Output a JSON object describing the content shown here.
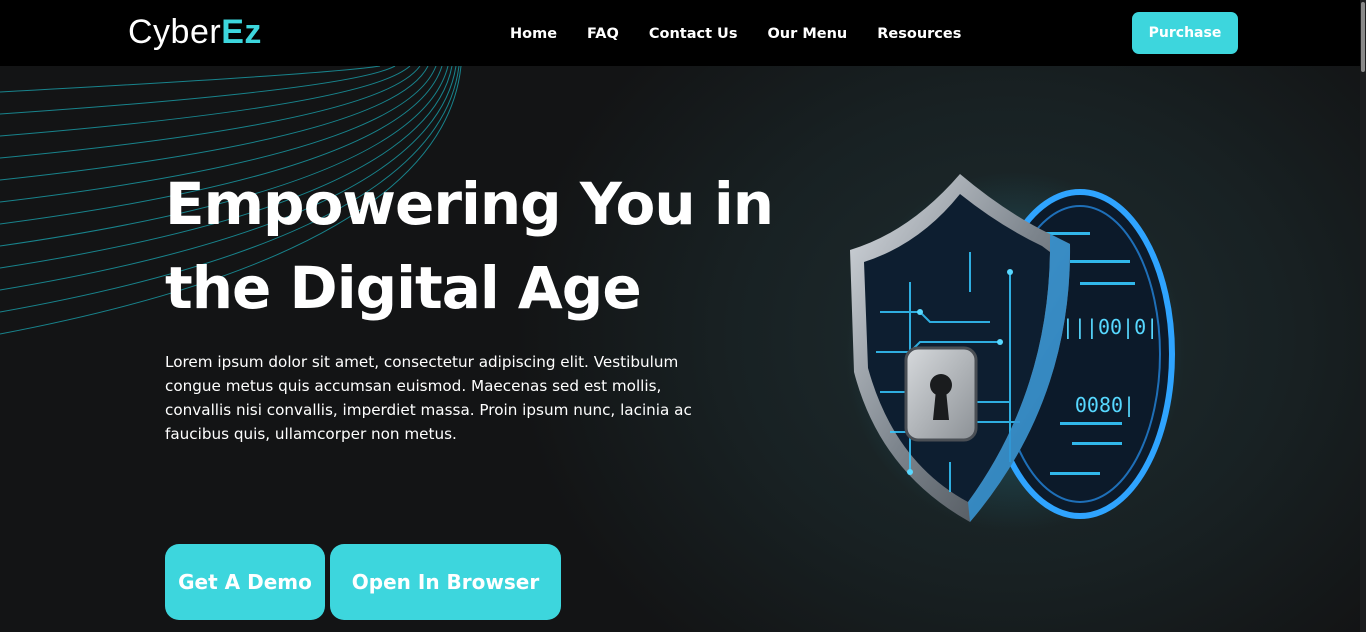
{
  "header": {
    "logo": {
      "part1": "Cyber",
      "part2": "Ez"
    },
    "nav": [
      "Home",
      "FAQ",
      "Contact Us",
      "Our Menu",
      "Resources"
    ],
    "purchase_label": "Purchase"
  },
  "hero": {
    "title_line1": "Empowering You in",
    "title_line2": "the Digital Age",
    "description": "Lorem ipsum dolor sit amet, consectetur adipiscing elit. Vestibulum congue metus quis accumsan euismod. Maecenas sed est mollis, convallis nisi convallis, imperdiet massa. Proin ipsum nunc, lacinia ac faucibus quis, ullamcorper non metus.",
    "buttons": {
      "demo": "Get A Demo",
      "browser": "Open In Browser"
    },
    "illustration": {
      "icon": "shield-lock-icon",
      "code_text_1": "|||00|0|",
      "code_text_2": "0080|"
    }
  },
  "colors": {
    "accent": "#3dd6dd",
    "background": "#131415",
    "navbar": "#000000"
  }
}
